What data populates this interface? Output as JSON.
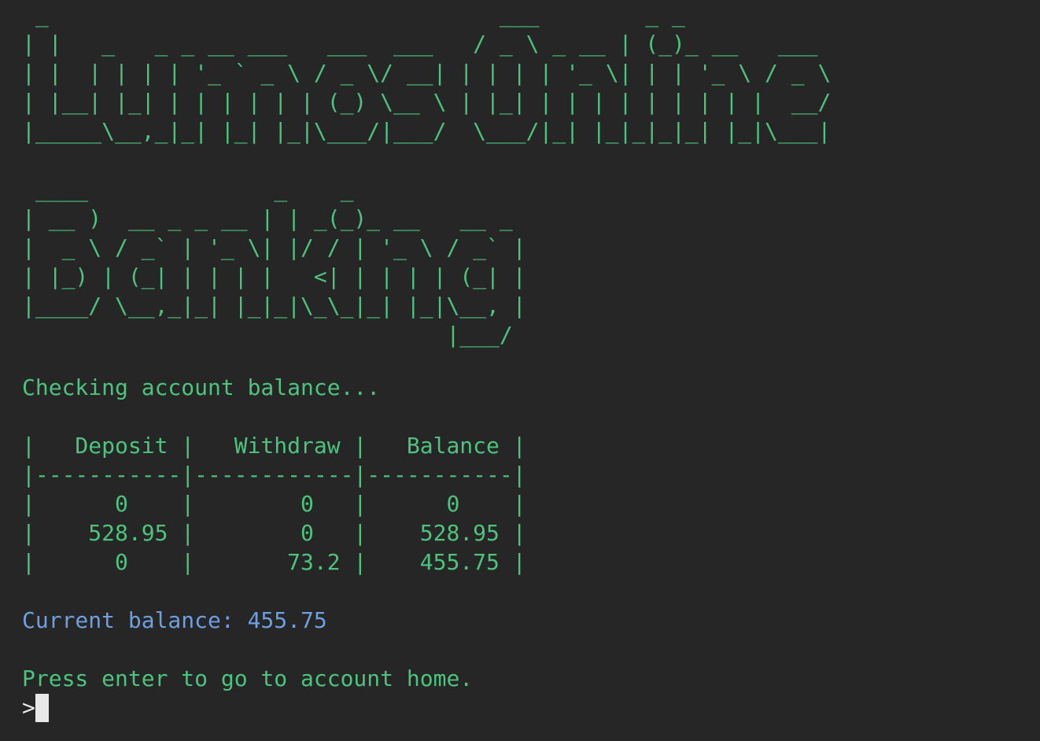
{
  "banner": {
    "title_art": " _                                  ___        _ _\n| |   _   _ _ __ ___   ___  ___   / _ \\ _ __ | (_)_ __   ___\n| |  | | | | '_ ` _ \\ / _ \\/ __| | | | | '_ \\| | | '_ \\ / _ \\\n| |__| |_| | | | | | | (_) \\__ \\ | |_| | | | | | | | | |  __/\n|_____\\__,_|_| |_| |_|\\___/|___/  \\___/|_| |_|_|_|_| |_|\\___|\n\n ____              _    _\n| __ )  __ _ _ __ | | _(_)_ __   __ _\n|  _ \\ / _` | '_ \\| |/ / | '_ \\ / _` |\n| |_) | (_| | | | |   <| | | | | (_| |\n|____/ \\__,_|_| |_|_|\\_\\_|_| |_|\\__, |\n                                |___/"
  },
  "status": {
    "message": "Checking account balance..."
  },
  "ledger": {
    "table_text": "|   Deposit |   Withdraw |   Balance |\n|-----------|------------|-----------|\n|      0    |        0   |      0    |\n|    528.95 |        0   |    528.95 |\n|      0    |       73.2 |    455.75 |",
    "columns": [
      "Deposit",
      "Withdraw",
      "Balance"
    ],
    "rows": [
      [
        "0",
        "0",
        "0"
      ],
      [
        "528.95",
        "0",
        "528.95"
      ],
      [
        "0",
        "73.2",
        "455.75"
      ]
    ]
  },
  "summary": {
    "current_balance_text": "Current balance: 455.75",
    "current_balance_value": "455.75"
  },
  "prompt": {
    "message": "Press enter to go to account home.",
    "symbol": ">"
  },
  "colors": {
    "background": "#262626",
    "text_green": "#4cc47d",
    "text_blue": "#6e9fe0",
    "cursor": "#e8e8e8"
  }
}
